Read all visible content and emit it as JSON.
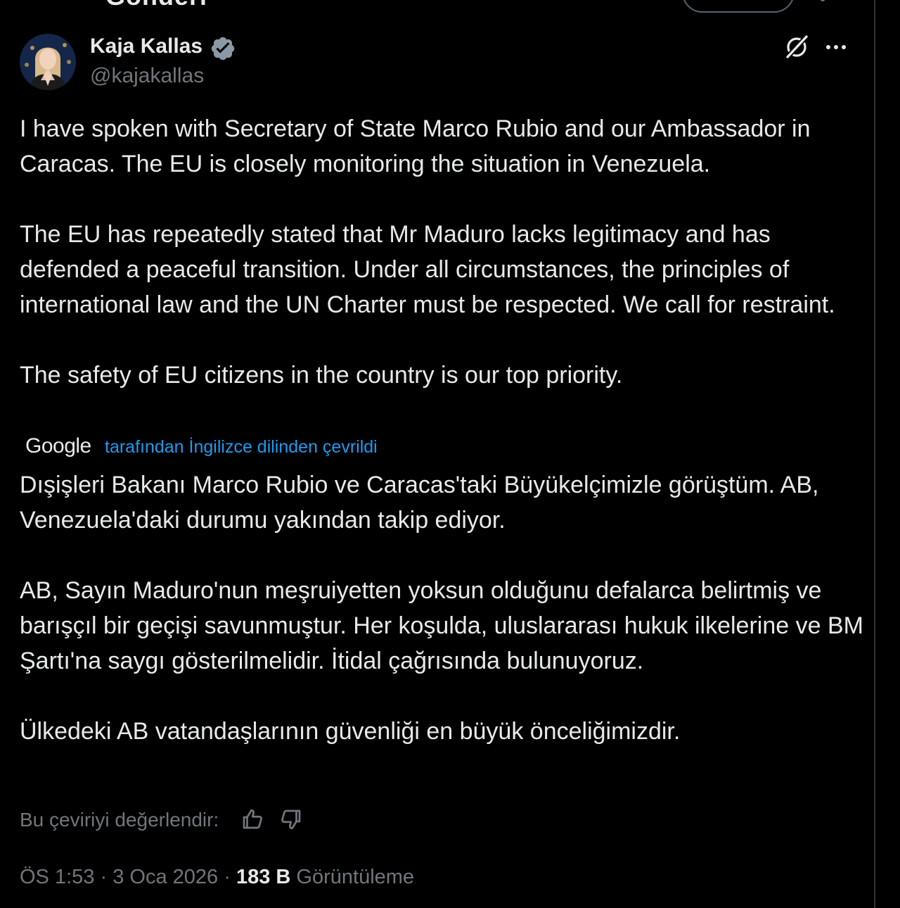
{
  "header_partial": {
    "title_fragment": "Gönderi"
  },
  "author": {
    "name": "Kaja Kallas",
    "handle": "@kajakallas",
    "verified_color": "#1d9bf0"
  },
  "tweet": {
    "original_text": "I have spoken with Secretary of State Marco Rubio and our Ambassador in Caracas. The EU is closely monitoring the situation in Venezuela.\n\nThe EU has repeatedly stated that Mr Maduro lacks legitimacy and has defended a peaceful transition. Under all circumstances, the principles of international law and the UN Charter must be respected. We call for restraint.\n\nThe safety of EU citizens in the country is our top priority.",
    "translation_provider": "Google",
    "translation_notice": "tarafından İngilizce dilinden çevrildi",
    "translated_text": "Dışişleri Bakanı Marco Rubio ve Caracas'taki Büyükelçimizle görüştüm. AB, Venezuela'daki durumu yakından takip ediyor.\n\nAB, Sayın Maduro'nun meşruiyetten yoksun olduğunu defalarca belirtmiş ve barışçıl bir geçişi savunmuştur. Her koşulda, uluslararası hukuk ilkelerine ve BM Şartı'na saygı gösterilmelidir. İtidal çağrısında bulunuyoruz.\n\nÜlkedeki AB vatandaşlarının güvenliği en büyük önceliğimizdir.",
    "rate_label": "Bu çeviriyi değerlendir:"
  },
  "meta": {
    "time": "ÖS 1:53",
    "separator": "·",
    "date": "3 Oca 2026",
    "views_count": "183 B",
    "views_label": "Görüntüleme"
  },
  "icons": {
    "verified": "verified-badge-icon",
    "grok": "grok-icon",
    "more": "more-dots-icon",
    "thumbs_up": "thumbs-up-icon",
    "thumbs_down": "thumbs-down-icon"
  },
  "colors": {
    "background": "#000000",
    "text_primary": "#e7e9ea",
    "text_secondary": "#71767b",
    "link": "#1d9bf0"
  }
}
